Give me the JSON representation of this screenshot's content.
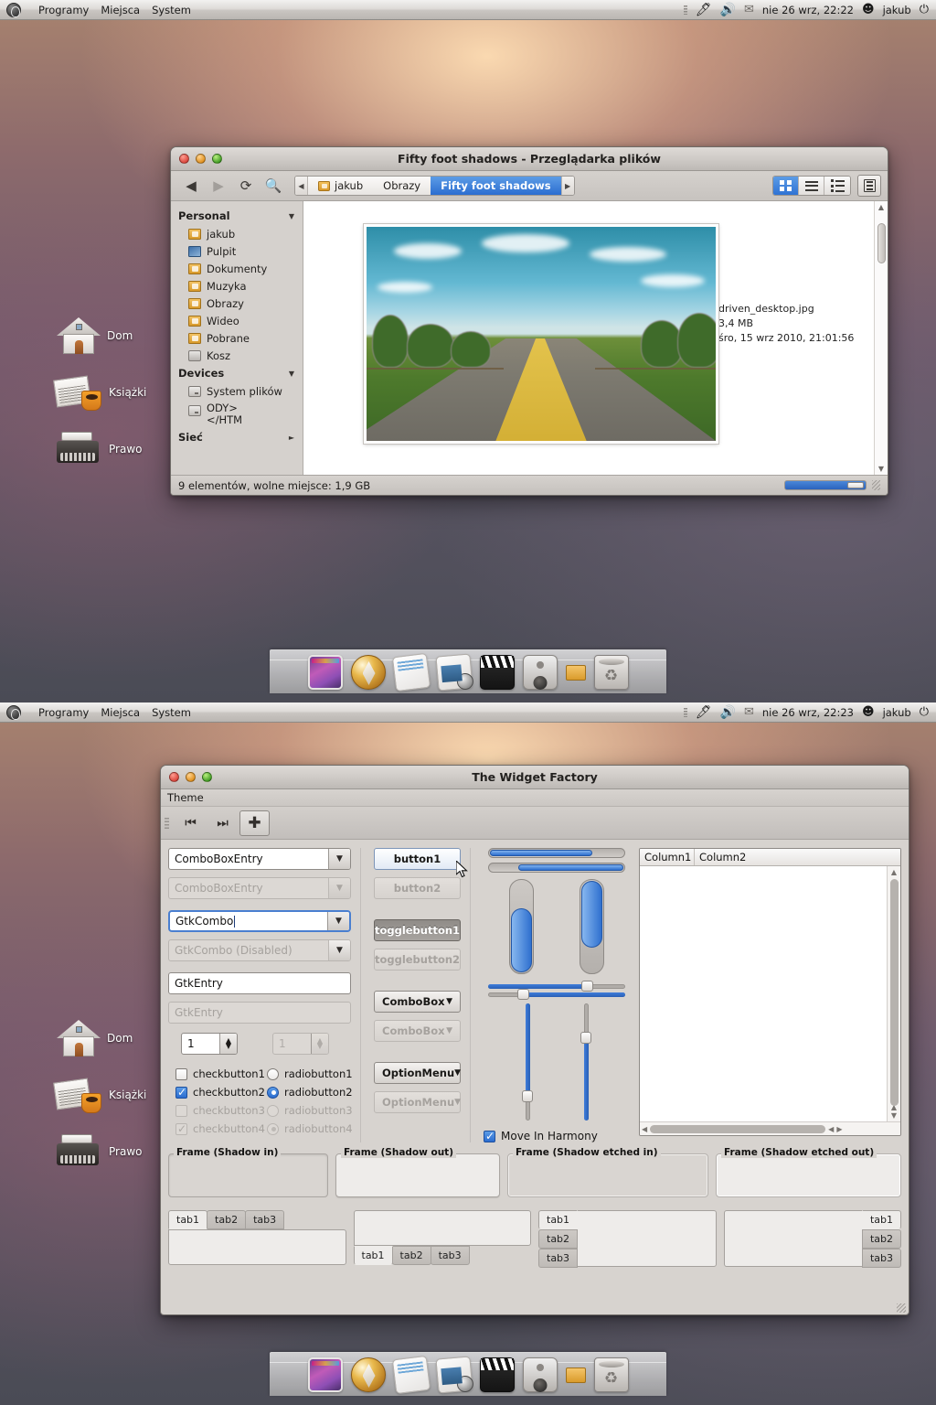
{
  "panel_top": {
    "menus": [
      "Programy",
      "Miejsca",
      "System"
    ],
    "clock": "nie 26 wrz, 22:22",
    "user": "jakub",
    "logo_icon": "gnome-foot-icon",
    "tray_icons": [
      "grip-icon",
      "bluetooth-icon",
      "volume-icon",
      "mail-icon",
      "avatar-icon",
      "power-icon"
    ]
  },
  "panel_bottom": {
    "menus": [
      "Programy",
      "Miejsca",
      "System"
    ],
    "clock": "nie 26 wrz, 22:23",
    "user": "jakub",
    "logo_icon": "gnome-foot-icon"
  },
  "desktop_icons_top": [
    {
      "label": "Dom",
      "icon": "house-icon"
    },
    {
      "label": "Książki",
      "icon": "newspaper-coffee-icon"
    },
    {
      "label": "Prawo",
      "icon": "typewriter-icon"
    }
  ],
  "desktop_icons_bottom": [
    {
      "label": "Dom",
      "icon": "house-icon"
    },
    {
      "label": "Książki",
      "icon": "newspaper-coffee-icon"
    },
    {
      "label": "Prawo",
      "icon": "typewriter-icon"
    }
  ],
  "dock": {
    "items": [
      {
        "name": "display-preferences-icon"
      },
      {
        "name": "web-browser-icon"
      },
      {
        "name": "text-editor-icon"
      },
      {
        "name": "photo-manager-icon"
      },
      {
        "name": "movie-player-icon"
      },
      {
        "name": "sound-preferences-icon"
      },
      {
        "name": "folder-icon"
      },
      {
        "name": "trash-icon"
      }
    ]
  },
  "file_manager": {
    "title": "Fifty foot shadows - Przeglądarka plików",
    "window_buttons": [
      "close-button",
      "minimize-button",
      "maximize-button"
    ],
    "toolbar": {
      "back_icon": "back-arrow-icon",
      "forward_icon": "forward-arrow-icon",
      "reload_icon": "reload-icon",
      "search_icon": "search-icon"
    },
    "breadcrumb": {
      "left_arrow": "◀",
      "right_arrow": "▶",
      "items": [
        {
          "label": "jakub",
          "icon": "home-folder-icon",
          "active": false
        },
        {
          "label": "Obrazy",
          "icon": "",
          "active": false
        },
        {
          "label": "Fifty foot shadows",
          "icon": "",
          "active": true
        }
      ]
    },
    "view_buttons": [
      {
        "name": "icon-view-button",
        "icon": "grid-icon",
        "selected": true
      },
      {
        "name": "list-view-button",
        "icon": "lines-icon",
        "selected": false
      },
      {
        "name": "compact-view-button",
        "icon": "bullets-icon",
        "selected": false
      }
    ],
    "extra_button": {
      "name": "properties-button",
      "icon": "properties-icon"
    },
    "sidebar": {
      "sections": [
        {
          "title": "Personal",
          "expander": "▼",
          "items": [
            {
              "label": "jakub",
              "icon": "folder-icon"
            },
            {
              "label": "Pulpit",
              "icon": "desktop-icon"
            },
            {
              "label": "Dokumenty",
              "icon": "documents-folder-icon"
            },
            {
              "label": "Muzyka",
              "icon": "music-folder-icon"
            },
            {
              "label": "Obrazy",
              "icon": "pictures-folder-icon"
            },
            {
              "label": "Wideo",
              "icon": "video-folder-icon"
            },
            {
              "label": "Pobrane",
              "icon": "downloads-folder-icon"
            },
            {
              "label": "Kosz",
              "icon": "trash-icon"
            }
          ]
        },
        {
          "title": "Devices",
          "expander": "▼",
          "items": [
            {
              "label": "System plików",
              "icon": "drive-icon"
            },
            {
              "label": "ODY>\n</HTM",
              "icon": "drive-icon"
            }
          ]
        },
        {
          "title": "Sieć",
          "expander": "►",
          "items": []
        }
      ]
    },
    "selected_file": {
      "name": "driven_desktop.jpg",
      "size": "3,4 MB",
      "date": "śro, 15 wrz 2010, 21:01:56"
    },
    "status": "9 elementów, wolne miejsce: 1,9 GB"
  },
  "widget_factory": {
    "title": "The Widget Factory",
    "menu": [
      "Theme"
    ],
    "toolbar": [
      {
        "name": "first-button",
        "icon": "go-first-icon",
        "pressed": false
      },
      {
        "name": "last-button",
        "icon": "go-last-icon",
        "pressed": false
      },
      {
        "name": "add-button",
        "icon": "plus-icon",
        "pressed": true
      }
    ],
    "column_a": {
      "combo_entry_1": "ComboBoxEntry",
      "combo_entry_2": "ComboBoxEntry",
      "gtk_combo_1": "GtkCombo",
      "gtk_combo_2": "GtkCombo (Disabled)",
      "entry_1": "GtkEntry",
      "entry_2": "GtkEntry",
      "spin_1": "1",
      "spin_2": "1",
      "checks": [
        {
          "label": "checkbutton1",
          "checked": false,
          "disabled": false
        },
        {
          "label": "checkbutton2",
          "checked": true,
          "disabled": false
        },
        {
          "label": "checkbutton3",
          "checked": false,
          "disabled": true
        },
        {
          "label": "checkbutton4",
          "checked": true,
          "disabled": true
        }
      ],
      "radios": [
        {
          "label": "radiobutton1",
          "checked": false,
          "disabled": false
        },
        {
          "label": "radiobutton2",
          "checked": true,
          "disabled": false
        },
        {
          "label": "radiobutton3",
          "checked": false,
          "disabled": true
        },
        {
          "label": "radiobutton4",
          "checked": true,
          "disabled": true
        }
      ]
    },
    "column_b": {
      "button1": "button1",
      "button2": "button2",
      "togglebutton1": "togglebutton1",
      "togglebutton2": "togglebutton2",
      "combobox1": "ComboBox",
      "combobox2": "ComboBox",
      "optionmenu1": "OptionMenu",
      "optionmenu2": "OptionMenu",
      "dropdown_arrow": "▼"
    },
    "column_c": {
      "progress_h1": 76,
      "progress_h2": 78,
      "progress_v1": 68,
      "progress_v2": 72,
      "scale_h1": 72,
      "scale_h2": 25,
      "scale_v1": 22,
      "scale_v2": 70,
      "harmony_label": "Move In Harmony",
      "harmony_checked": true
    },
    "column_d": {
      "columns": [
        "Column1",
        "Column2"
      ],
      "rows": []
    },
    "frames": [
      "Frame (Shadow in)",
      "Frame (Shadow out)",
      "Frame (Shadow etched in)",
      "Frame (Shadow etched out)"
    ],
    "notebooks": [
      {
        "position": "top",
        "tabs": [
          "tab1",
          "tab2",
          "tab3"
        ],
        "active": 0
      },
      {
        "position": "bottom",
        "tabs": [
          "tab1",
          "tab2",
          "tab3"
        ],
        "active": 0
      },
      {
        "position": "left",
        "tabs": [
          "tab1",
          "tab2",
          "tab3"
        ],
        "active": 0
      },
      {
        "position": "right",
        "tabs": [
          "tab1",
          "tab2",
          "tab3"
        ],
        "active": 0
      }
    ]
  },
  "colors": {
    "accent": "#2b6dd0",
    "panel_bg": "#dedbd8",
    "window_bg": "#d7d3cf"
  }
}
